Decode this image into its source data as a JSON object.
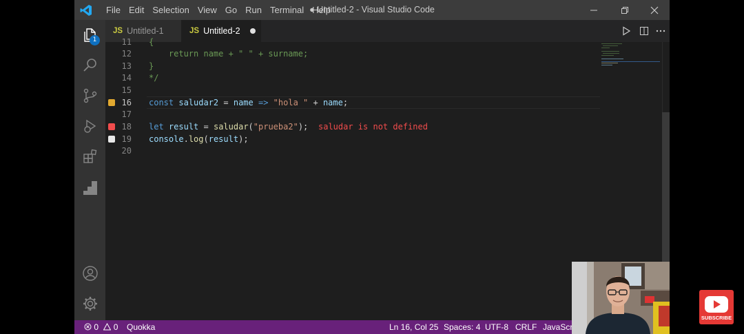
{
  "window": {
    "title": "● Untitled-2 - Visual Studio Code",
    "menu": [
      "File",
      "Edit",
      "Selection",
      "View",
      "Go",
      "Run",
      "Terminal",
      "Help"
    ]
  },
  "activity": {
    "explorer_badge": "1"
  },
  "tabs": [
    {
      "lang": "JS",
      "label": "Untitled-1",
      "active": false
    },
    {
      "lang": "JS",
      "label": "Untitled-2",
      "active": true,
      "dirty": true
    }
  ],
  "editor": {
    "lines": [
      {
        "no": "11",
        "text": "{"
      },
      {
        "no": "12",
        "text": "    return name + \" \" + surname;"
      },
      {
        "no": "13",
        "text": "}"
      },
      {
        "no": "14",
        "text": "*/"
      },
      {
        "no": "15",
        "text": ""
      },
      {
        "no": "16",
        "text": "const saludar2 = name => \"hola \" + name;"
      },
      {
        "no": "17",
        "text": ""
      },
      {
        "no": "18",
        "text": "let result = saludar(\"prueba2\");"
      },
      {
        "no": "19",
        "text": "console.log(result);"
      },
      {
        "no": "20",
        "text": ""
      }
    ],
    "inline_error": "saludar is not defined",
    "current_line": "16"
  },
  "status": {
    "errors": "0",
    "warnings": "0",
    "quokka": "Quokka",
    "position": "Ln 16, Col 25",
    "spaces": "Spaces: 4",
    "encoding": "UTF-8",
    "eol": "CRLF",
    "language": "JavaScript"
  },
  "youtube": {
    "label": "SUBSCRIBE"
  },
  "colors": {
    "status_bar": "#68217a",
    "accent": "#0e70c0",
    "error": "#f14c4c",
    "bp_yellow": "#e2a930",
    "bp_red": "#f14c4c"
  }
}
